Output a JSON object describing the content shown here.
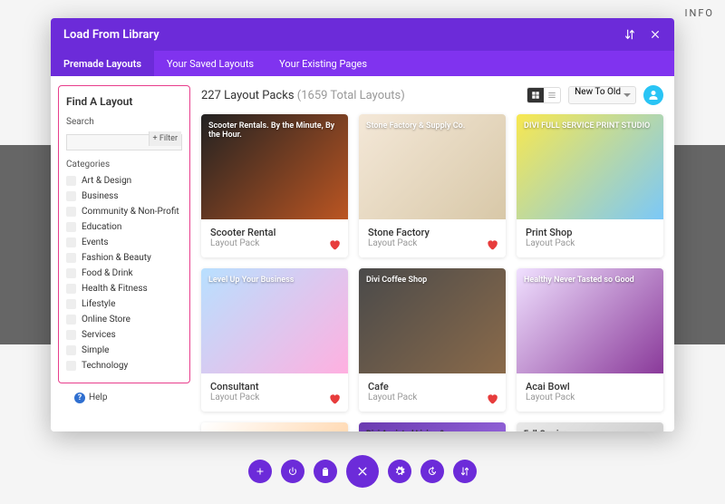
{
  "info_label": "INFO",
  "modal": {
    "title": "Load From Library",
    "tabs": [
      "Premade Layouts",
      "Your Saved Layouts",
      "Your Existing Pages"
    ],
    "active_tab": 0
  },
  "sidebar": {
    "title": "Find A Layout",
    "search_label": "Search",
    "filter_label": "+ Filter",
    "categories_label": "Categories",
    "categories": [
      "Art & Design",
      "Business",
      "Community & Non-Profit",
      "Education",
      "Events",
      "Fashion & Beauty",
      "Food & Drink",
      "Health & Fitness",
      "Lifestyle",
      "Online Store",
      "Services",
      "Simple",
      "Technology"
    ],
    "help_label": "Help"
  },
  "main": {
    "count": "227 Layout Packs",
    "total": "(1659 Total Layouts)",
    "sort": "New To Old"
  },
  "cards": [
    {
      "title": "Scooter Rental",
      "sub": "Layout Pack",
      "thumb_text": "Scooter Rentals. By the Minute, By the Hour.",
      "heart": true,
      "thumb_class": "t1"
    },
    {
      "title": "Stone Factory",
      "sub": "Layout Pack",
      "thumb_text": "Stone Factory & Supply Co.",
      "heart": true,
      "thumb_class": "t2"
    },
    {
      "title": "Print Shop",
      "sub": "Layout Pack",
      "thumb_text": "DIVI FULL SERVICE PRINT STUDIO",
      "heart": false,
      "thumb_class": "t3"
    },
    {
      "title": "Consultant",
      "sub": "Layout Pack",
      "thumb_text": "Level Up Your Business",
      "heart": true,
      "thumb_class": "t4"
    },
    {
      "title": "Cafe",
      "sub": "Layout Pack",
      "thumb_text": "Divi Coffee Shop",
      "heart": true,
      "thumb_class": "t5"
    },
    {
      "title": "Acai Bowl",
      "sub": "Layout Pack",
      "thumb_text": "Healthy Never Tasted so Good",
      "heart": false,
      "thumb_class": "t6"
    }
  ],
  "partial_cards": [
    {
      "thumb_text": "",
      "thumb_class": "t7"
    },
    {
      "thumb_text": "Divi Assisted Living &",
      "thumb_class": "t8"
    },
    {
      "thumb_text": "Full-Service",
      "thumb_class": "t9"
    }
  ]
}
